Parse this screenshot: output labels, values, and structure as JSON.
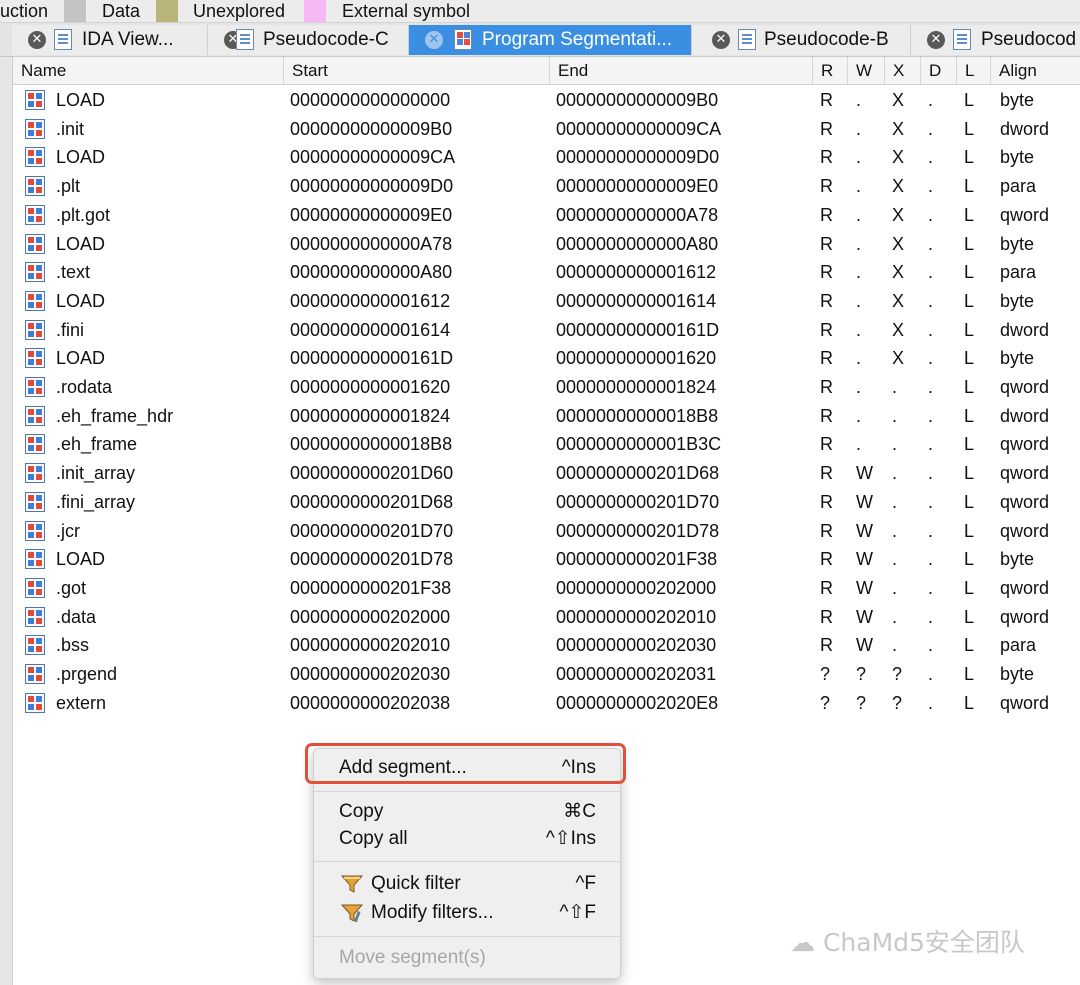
{
  "legend": {
    "items": [
      {
        "label": "uction",
        "swatch": ""
      },
      {
        "label": "Data",
        "swatch": "#c4c4c4"
      },
      {
        "label": "Unexplored",
        "swatch": "#b8b57a"
      },
      {
        "label": "External symbol",
        "swatch": "#f7b9f5"
      }
    ]
  },
  "tabs": [
    {
      "label": "IDA View...",
      "active": false
    },
    {
      "label": "Pseudocode-C",
      "active": false
    },
    {
      "label": "Program Segmentati...",
      "active": true
    },
    {
      "label": "Pseudocode-B",
      "active": false
    },
    {
      "label": "Pseudocod",
      "active": false
    }
  ],
  "table": {
    "headers": [
      "Name",
      "Start",
      "End",
      "R",
      "W",
      "X",
      "D",
      "L",
      "Align"
    ],
    "rows": [
      {
        "name": "LOAD",
        "start": "0000000000000000",
        "end": "00000000000009B0",
        "r": "R",
        "w": ".",
        "x": "X",
        "d": ".",
        "l": "L",
        "align": "byte"
      },
      {
        "name": ".init",
        "start": "00000000000009B0",
        "end": "00000000000009CA",
        "r": "R",
        "w": ".",
        "x": "X",
        "d": ".",
        "l": "L",
        "align": "dword"
      },
      {
        "name": "LOAD",
        "start": "00000000000009CA",
        "end": "00000000000009D0",
        "r": "R",
        "w": ".",
        "x": "X",
        "d": ".",
        "l": "L",
        "align": "byte"
      },
      {
        "name": ".plt",
        "start": "00000000000009D0",
        "end": "00000000000009E0",
        "r": "R",
        "w": ".",
        "x": "X",
        "d": ".",
        "l": "L",
        "align": "para"
      },
      {
        "name": ".plt.got",
        "start": "00000000000009E0",
        "end": "0000000000000A78",
        "r": "R",
        "w": ".",
        "x": "X",
        "d": ".",
        "l": "L",
        "align": "qword"
      },
      {
        "name": "LOAD",
        "start": "0000000000000A78",
        "end": "0000000000000A80",
        "r": "R",
        "w": ".",
        "x": "X",
        "d": ".",
        "l": "L",
        "align": "byte"
      },
      {
        "name": ".text",
        "start": "0000000000000A80",
        "end": "0000000000001612",
        "r": "R",
        "w": ".",
        "x": "X",
        "d": ".",
        "l": "L",
        "align": "para"
      },
      {
        "name": "LOAD",
        "start": "0000000000001612",
        "end": "0000000000001614",
        "r": "R",
        "w": ".",
        "x": "X",
        "d": ".",
        "l": "L",
        "align": "byte"
      },
      {
        "name": ".fini",
        "start": "0000000000001614",
        "end": "000000000000161D",
        "r": "R",
        "w": ".",
        "x": "X",
        "d": ".",
        "l": "L",
        "align": "dword"
      },
      {
        "name": "LOAD",
        "start": "000000000000161D",
        "end": "0000000000001620",
        "r": "R",
        "w": ".",
        "x": "X",
        "d": ".",
        "l": "L",
        "align": "byte"
      },
      {
        "name": ".rodata",
        "start": "0000000000001620",
        "end": "0000000000001824",
        "r": "R",
        "w": ".",
        "x": ".",
        "d": ".",
        "l": "L",
        "align": "qword"
      },
      {
        "name": ".eh_frame_hdr",
        "start": "0000000000001824",
        "end": "00000000000018B8",
        "r": "R",
        "w": ".",
        "x": ".",
        "d": ".",
        "l": "L",
        "align": "dword"
      },
      {
        "name": ".eh_frame",
        "start": "00000000000018B8",
        "end": "0000000000001B3C",
        "r": "R",
        "w": ".",
        "x": ".",
        "d": ".",
        "l": "L",
        "align": "qword"
      },
      {
        "name": ".init_array",
        "start": "0000000000201D60",
        "end": "0000000000201D68",
        "r": "R",
        "w": "W",
        "x": ".",
        "d": ".",
        "l": "L",
        "align": "qword"
      },
      {
        "name": ".fini_array",
        "start": "0000000000201D68",
        "end": "0000000000201D70",
        "r": "R",
        "w": "W",
        "x": ".",
        "d": ".",
        "l": "L",
        "align": "qword"
      },
      {
        "name": ".jcr",
        "start": "0000000000201D70",
        "end": "0000000000201D78",
        "r": "R",
        "w": "W",
        "x": ".",
        "d": ".",
        "l": "L",
        "align": "qword"
      },
      {
        "name": "LOAD",
        "start": "0000000000201D78",
        "end": "0000000000201F38",
        "r": "R",
        "w": "W",
        "x": ".",
        "d": ".",
        "l": "L",
        "align": "byte"
      },
      {
        "name": ".got",
        "start": "0000000000201F38",
        "end": "0000000000202000",
        "r": "R",
        "w": "W",
        "x": ".",
        "d": ".",
        "l": "L",
        "align": "qword"
      },
      {
        "name": ".data",
        "start": "0000000000202000",
        "end": "0000000000202010",
        "r": "R",
        "w": "W",
        "x": ".",
        "d": ".",
        "l": "L",
        "align": "qword"
      },
      {
        "name": ".bss",
        "start": "0000000000202010",
        "end": "0000000000202030",
        "r": "R",
        "w": "W",
        "x": ".",
        "d": ".",
        "l": "L",
        "align": "para"
      },
      {
        "name": ".prgend",
        "start": "0000000000202030",
        "end": "0000000000202031",
        "r": "?",
        "w": "?",
        "x": "?",
        "d": ".",
        "l": "L",
        "align": "byte"
      },
      {
        "name": "extern",
        "start": "0000000000202038",
        "end": "00000000002020E8",
        "r": "?",
        "w": "?",
        "x": "?",
        "d": ".",
        "l": "L",
        "align": "qword"
      }
    ]
  },
  "context_menu": {
    "items": [
      {
        "label": "Add segment...",
        "shortcut": "^Ins",
        "highlighted": true
      },
      {
        "label": "Copy",
        "shortcut": "⌘C"
      },
      {
        "label": "Copy all",
        "shortcut": "^⇧Ins"
      },
      {
        "label": "Quick filter",
        "shortcut": "^F",
        "icon": "funnel-icon"
      },
      {
        "label": "Modify filters...",
        "shortcut": "^⇧F",
        "icon": "funnel-wrench-icon"
      },
      {
        "label": "Move segment(s)",
        "shortcut": "",
        "disabled": true
      }
    ]
  },
  "watermark": "ChaMd5安全团队",
  "colors": {
    "accent": "#3b8fe3",
    "highlight_border": "#e0503a"
  }
}
